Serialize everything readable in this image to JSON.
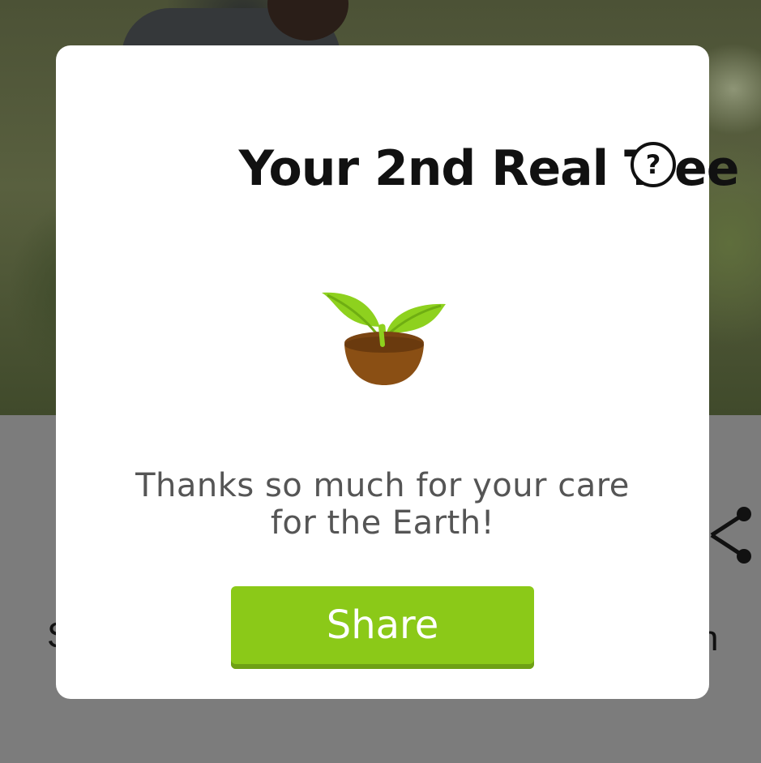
{
  "dialog": {
    "title": "Your 2nd Real Tree",
    "help_label": "?",
    "message_line1": "Thanks so much for your care",
    "message_line2": "for the Earth!",
    "share_label": "Share"
  },
  "background": {
    "text_left": "S",
    "text_right": "n"
  },
  "colors": {
    "accent": "#8bc918",
    "accent_shadow": "#6ea014",
    "leaf": "#8ed11e",
    "pot": "#8a4f14",
    "overlay_gray": "#7c7c7c"
  },
  "icons": {
    "help": "question-circle-icon",
    "illustration": "sprout-in-pot-icon",
    "background_share": "share-icon"
  }
}
